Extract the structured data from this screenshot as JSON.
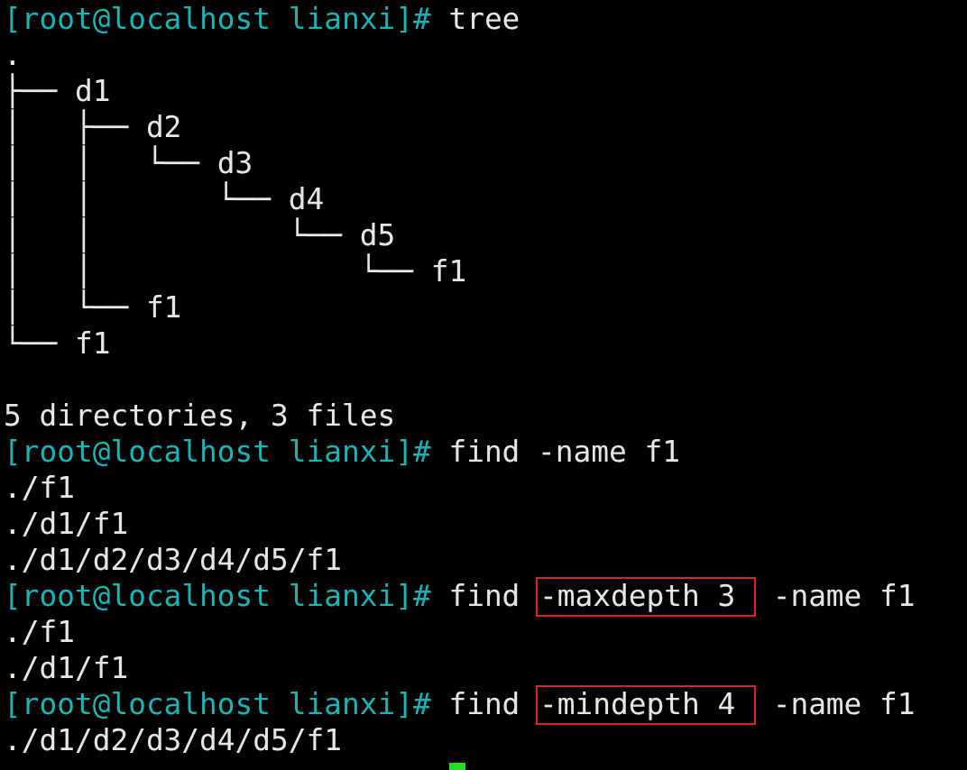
{
  "terminal": {
    "lines": [
      {
        "kind": "prompt",
        "prompt": "[root@localhost lianxi]#",
        "parts": [
          {
            "text": "tree",
            "boxed": false
          }
        ]
      },
      {
        "kind": "output",
        "text": "."
      },
      {
        "kind": "output",
        "text": "├── d1"
      },
      {
        "kind": "output",
        "text": "│   ├── d2"
      },
      {
        "kind": "output",
        "text": "│   │   └── d3"
      },
      {
        "kind": "output",
        "text": "│   │       └── d4"
      },
      {
        "kind": "output",
        "text": "│   │           └── d5"
      },
      {
        "kind": "output",
        "text": "│   │               └── f1"
      },
      {
        "kind": "output",
        "text": "│   └── f1"
      },
      {
        "kind": "output",
        "text": "└── f1"
      },
      {
        "kind": "blank"
      },
      {
        "kind": "output",
        "text": "5 directories, 3 files"
      },
      {
        "kind": "prompt",
        "prompt": "[root@localhost lianxi]#",
        "parts": [
          {
            "text": "find -name f1",
            "boxed": false
          }
        ]
      },
      {
        "kind": "output",
        "text": "./f1"
      },
      {
        "kind": "output",
        "text": "./d1/f1"
      },
      {
        "kind": "output",
        "text": "./d1/d2/d3/d4/d5/f1"
      },
      {
        "kind": "prompt",
        "prompt": "[root@localhost lianxi]#",
        "parts": [
          {
            "text": "find",
            "boxed": false
          },
          {
            "text": "-maxdepth 3 ",
            "boxed": true
          },
          {
            "text": "-name f1",
            "boxed": false
          }
        ]
      },
      {
        "kind": "output",
        "text": "./f1"
      },
      {
        "kind": "output",
        "text": "./d1/f1"
      },
      {
        "kind": "prompt",
        "prompt": "[root@localhost lianxi]#",
        "parts": [
          {
            "text": "find",
            "boxed": false
          },
          {
            "text": "-mindepth 4 ",
            "boxed": true
          },
          {
            "text": "-name f1",
            "boxed": false
          }
        ]
      },
      {
        "kind": "output",
        "text": "./d1/d2/d3/d4/d5/f1"
      },
      {
        "kind": "cursor",
        "cursor": true
      }
    ]
  }
}
